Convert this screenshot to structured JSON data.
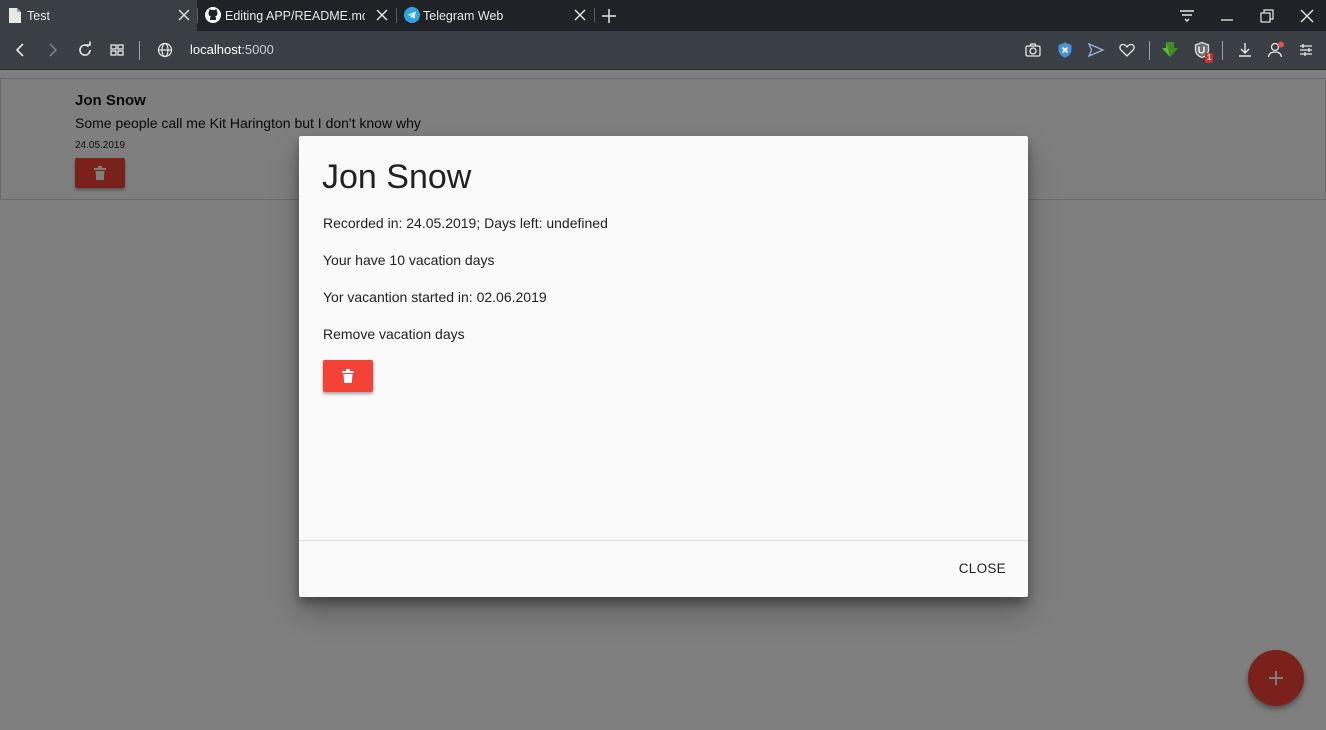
{
  "browser": {
    "tabs": [
      {
        "title": "Test",
        "icon": "document-icon",
        "active": true
      },
      {
        "title": "Editing APP/README.md a",
        "icon": "github-icon",
        "active": false
      },
      {
        "title": "Telegram Web",
        "icon": "telegram-icon",
        "active": false
      }
    ],
    "address": {
      "host": "localhost",
      "port": ":5000"
    },
    "extension_badge": "1"
  },
  "page": {
    "card": {
      "name": "Jon Snow",
      "description": "Some people call me Kit Harington but I don't know why",
      "date": "24.05.2019"
    }
  },
  "modal": {
    "title": "Jon Snow",
    "recorded": "Recorded in: 24.05.2019; Days left: undefined",
    "vacation_days": "Your have 10 vacation days",
    "vacation_start": "Yor vacantion started in: 02.06.2019",
    "remove_label": "Remove vacation days",
    "close_label": "CLOSE"
  },
  "colors": {
    "accent_red": "#f44336",
    "toolbar": "#3a3f45",
    "tabstrip": "#1f2226"
  }
}
